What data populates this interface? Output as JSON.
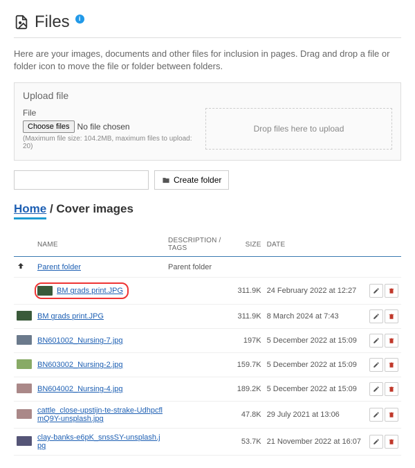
{
  "header": {
    "title": "Files"
  },
  "intro": "Here are your images, documents and other files for inclusion in pages. Drag and drop a file or folder icon to move the file or folder between folders.",
  "upload": {
    "panel_title": "Upload file",
    "file_label": "File",
    "choose_button": "Choose files",
    "no_file": "No file chosen",
    "hint": "(Maximum file size: 104.2MB, maximum files to upload: 20)",
    "dropzone": "Drop files here to upload"
  },
  "toolbar": {
    "folder_placeholder": "",
    "create_folder": "Create folder"
  },
  "breadcrumb": {
    "home": "Home",
    "sep": " / ",
    "current": "Cover images"
  },
  "columns": {
    "name": "NAME",
    "desc": "DESCRIPTION / TAGS",
    "size": "SIZE",
    "date": "DATE"
  },
  "parent_row": {
    "label": "Parent folder",
    "desc": "Parent folder"
  },
  "rows": [
    {
      "name": "BM grads print.JPG",
      "size": "311.9K",
      "date": "24 February 2022 at 12:27",
      "hl": true,
      "thumb": "v1"
    },
    {
      "name": "BM grads print.JPG",
      "size": "311.9K",
      "date": "8 March 2024 at 7:43",
      "hl": false,
      "thumb": "v1"
    },
    {
      "name": "BN601002_Nursing-7.jpg",
      "size": "197K",
      "date": "5 December 2022 at 15:09",
      "hl": false,
      "thumb": "v2"
    },
    {
      "name": "BN603002_Nursing-2.jpg",
      "size": "159.7K",
      "date": "5 December 2022 at 15:09",
      "hl": false,
      "thumb": "v3"
    },
    {
      "name": "BN604002_Nursing-4.jpg",
      "size": "189.2K",
      "date": "5 December 2022 at 15:09",
      "hl": false,
      "thumb": "v4"
    },
    {
      "name": "cattle_close-upstijn-te-strake-UdhpcflmQ9Y-unsplash.jpg",
      "size": "47.8K",
      "date": "29 July 2021 at 13:06",
      "hl": false,
      "thumb": "v4"
    },
    {
      "name": "clay-banks-e6pK_snssSY-unsplash.jpg",
      "size": "53.7K",
      "date": "21 November 2022 at 16:07",
      "hl": false,
      "thumb": "v5"
    }
  ]
}
